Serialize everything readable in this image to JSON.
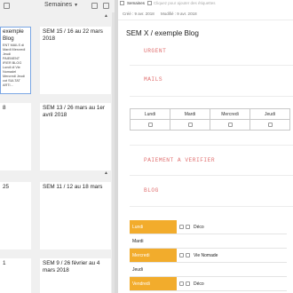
{
  "sidebar": {
    "title": "Semaines",
    "cards": [
      {
        "title": "exemple Blog",
        "snippet": "ENT MAILS di Mardi Mercredi Jeudi PAIEMENT IFIER BLOG Lundi di Vie Nomadel Mercredi Jeudi cot SULTAT ARTI...",
        "selected": true
      },
      {
        "title": "SEM 15 / 16 au 22 mars 2018",
        "snippet": "",
        "selected": false
      },
      {
        "title": "8",
        "snippet": "",
        "selected": false
      },
      {
        "title": "SEM 13 / 26 mars au 1er avril 2018",
        "snippet": "",
        "selected": false
      },
      {
        "title": "25",
        "snippet": "",
        "selected": false
      },
      {
        "title": "SEM 11 / 12 au 18 mars",
        "snippet": "",
        "selected": false
      },
      {
        "title": "1",
        "snippet": "",
        "selected": false
      },
      {
        "title": "SEM 9 / 26 février au 4 mars 2018",
        "snippet": "",
        "selected": false
      }
    ]
  },
  "note": {
    "notebook": "Semaines",
    "tags_placeholder": "Cliquez pour ajouter des étiquettes",
    "created": "Créé : 9 avr. 2018",
    "modified": "Modifié : 9 avr. 2018",
    "title": "SEM X / exemple Blog",
    "sections": {
      "urgent": "URGENT",
      "mails": "MAILS",
      "paiement": "PAIEMENT A VERIFIER",
      "blog": "BLOG"
    },
    "weekdays": [
      "Lundi",
      "Mardi",
      "Mercredi",
      "Jeudi"
    ],
    "blog_rows": [
      {
        "day": "Lundi",
        "highlight": true,
        "checkbox": true,
        "label": "Déco"
      },
      {
        "day": "Mardi",
        "highlight": false,
        "checkbox": false,
        "label": ""
      },
      {
        "day": "Mercredi",
        "highlight": true,
        "checkbox": true,
        "label": "Vie Nomade"
      },
      {
        "day": "Jeudi",
        "highlight": false,
        "checkbox": false,
        "label": ""
      },
      {
        "day": "Vendredi",
        "highlight": true,
        "checkbox": true,
        "label": "Déco"
      }
    ]
  },
  "colors": {
    "accent_orange": "#f2ac2c",
    "section_red": "#e07070",
    "selection_blue": "#7aa6e4"
  }
}
